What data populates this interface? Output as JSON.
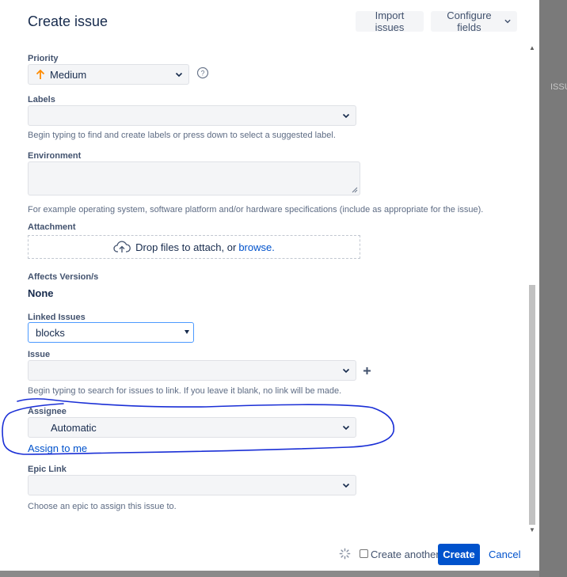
{
  "backdrop": {
    "text": "ISSU"
  },
  "dialog": {
    "title": "Create issue",
    "import_label": "Import issues",
    "configure_label": "Configure fields"
  },
  "fields": {
    "priority": {
      "label": "Priority",
      "value": "Medium",
      "icon": "arrow-up-icon",
      "icon_color": "#ff8b00"
    },
    "labels": {
      "label": "Labels",
      "help": "Begin typing to find and create labels or press down to select a suggested label."
    },
    "environment": {
      "label": "Environment",
      "help": "For example operating system, software platform and/or hardware specifications (include as appropriate for the issue)."
    },
    "attachment": {
      "label": "Attachment",
      "drop_text": "Drop files to attach, or",
      "browse": "browse."
    },
    "affects_version": {
      "label": "Affects Version/s",
      "value": "None"
    },
    "linked_issues": {
      "label": "Linked Issues",
      "value": "blocks"
    },
    "issue": {
      "label": "Issue",
      "help": "Begin typing to search for issues to link. If you leave it blank, no link will be made."
    },
    "assignee": {
      "label": "Assignee",
      "value": "Automatic",
      "assign_to_me": "Assign to me"
    },
    "epic_link": {
      "label": "Epic Link",
      "help": "Choose an epic to assign this issue to."
    }
  },
  "footer": {
    "create_another": "Create another",
    "create_another_checked": false,
    "create": "Create",
    "cancel": "Cancel"
  },
  "colors": {
    "primary": "#0052cc",
    "annotation": "#1a2fd6"
  }
}
